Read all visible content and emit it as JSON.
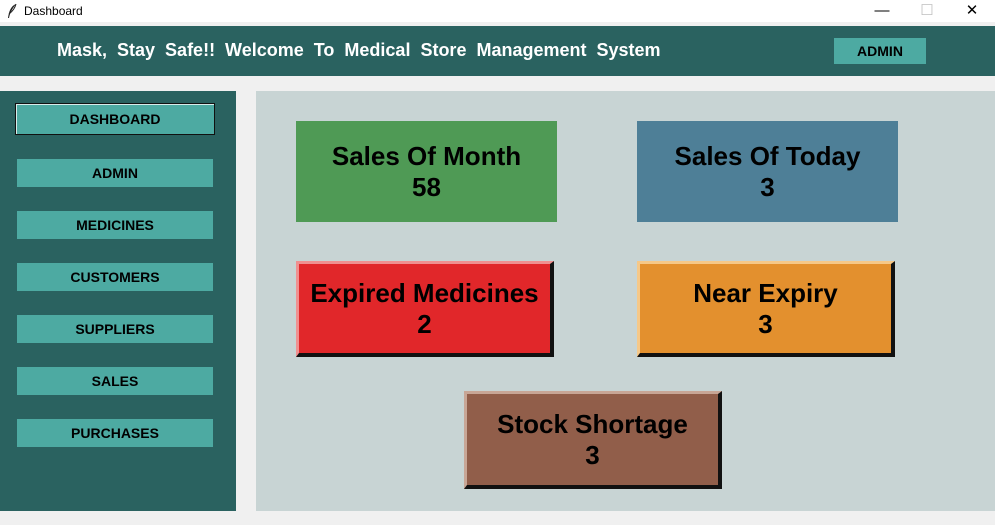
{
  "window": {
    "title": "Dashboard",
    "minimize_glyph": "—",
    "maximize_glyph": "☐",
    "close_glyph": "✕"
  },
  "header": {
    "marquee_text": "Mask, Stay Safe!!  Welcome To Medical Store Management System",
    "admin_label": "ADMIN"
  },
  "sidebar": {
    "items": [
      {
        "label": "DASHBOARD",
        "active": true
      },
      {
        "label": "ADMIN"
      },
      {
        "label": "MEDICINES"
      },
      {
        "label": "CUSTOMERS"
      },
      {
        "label": "SUPPLIERS"
      },
      {
        "label": "SALES"
      },
      {
        "label": "PURCHASES"
      }
    ]
  },
  "cards": {
    "sales_month": {
      "label": "Sales Of Month",
      "value": "58"
    },
    "sales_today": {
      "label": "Sales Of Today",
      "value": "3"
    },
    "expired": {
      "label": "Expired Medicines",
      "value": "2"
    },
    "near_expiry": {
      "label": "Near Expiry",
      "value": "3"
    },
    "stock_shortage": {
      "label": "Stock Shortage",
      "value": "3"
    }
  },
  "colors": {
    "header_bg": "#2a6260",
    "button_bg": "#4daaa2",
    "main_bg": "#c8d4d4",
    "sales_month": "#4f9a55",
    "sales_today": "#4e7f97",
    "expired": "#e1272a",
    "near_expiry": "#e3902e",
    "stock_shortage": "#915e4a"
  }
}
